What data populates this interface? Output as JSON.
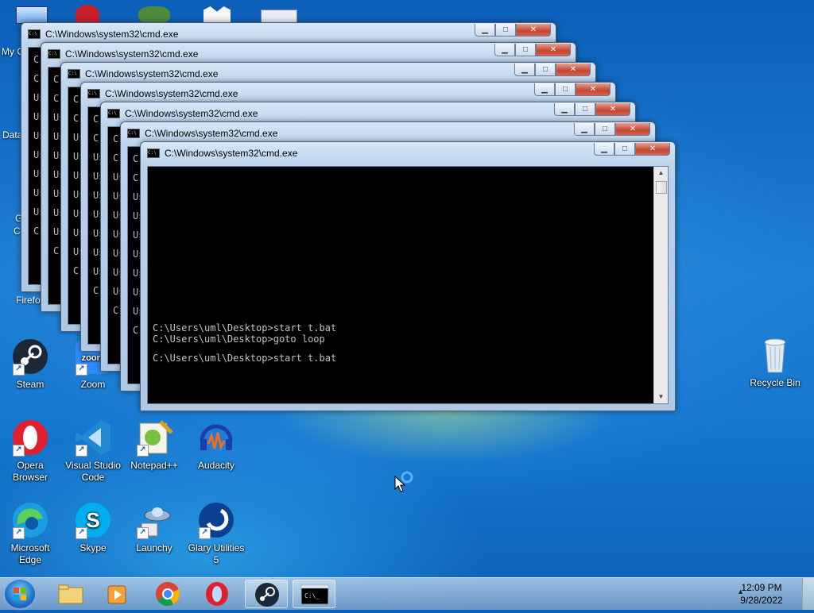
{
  "desktop": {
    "partial_labels": {
      "my_computer": "My C",
      "data": "Data",
      "g": "G",
      "c": "C",
      "firefox": "Firefo"
    },
    "icons": [
      {
        "label": "Steam"
      },
      {
        "label": "Zoom"
      },
      {
        "label": "Opera Browser"
      },
      {
        "label": "Visual Studio Code"
      },
      {
        "label": "Notepad++"
      },
      {
        "label": "Audacity"
      },
      {
        "label": "Microsoft Edge"
      },
      {
        "label": "Skype"
      },
      {
        "label": "Launchy"
      },
      {
        "label": "Glary Utilities 5"
      },
      {
        "label": "Recycle Bin"
      }
    ]
  },
  "windows": {
    "title": "C:\\Windows\\system32\\cmd.exe",
    "left_column_chars": [
      "C:",
      "C:",
      "Us",
      "Us",
      "Us",
      "Us",
      "Us",
      "Us",
      "Us",
      "C:"
    ],
    "console_lines": [
      "C:\\Users\\uml\\Desktop>start t.bat",
      "C:\\Users\\uml\\Desktop>goto loop",
      "C:\\Users\\uml\\Desktop>start t.bat"
    ]
  },
  "taskbar": {
    "time": "12:09 PM",
    "date": "9/28/2022",
    "items": [
      "windows-explorer",
      "media-player",
      "chrome",
      "opera",
      "steam",
      "command-prompt"
    ]
  },
  "colors": {
    "accent": "#1f7fd4",
    "close": "#c24632",
    "console_bg": "#000000",
    "console_text": "#c0c0c0"
  }
}
